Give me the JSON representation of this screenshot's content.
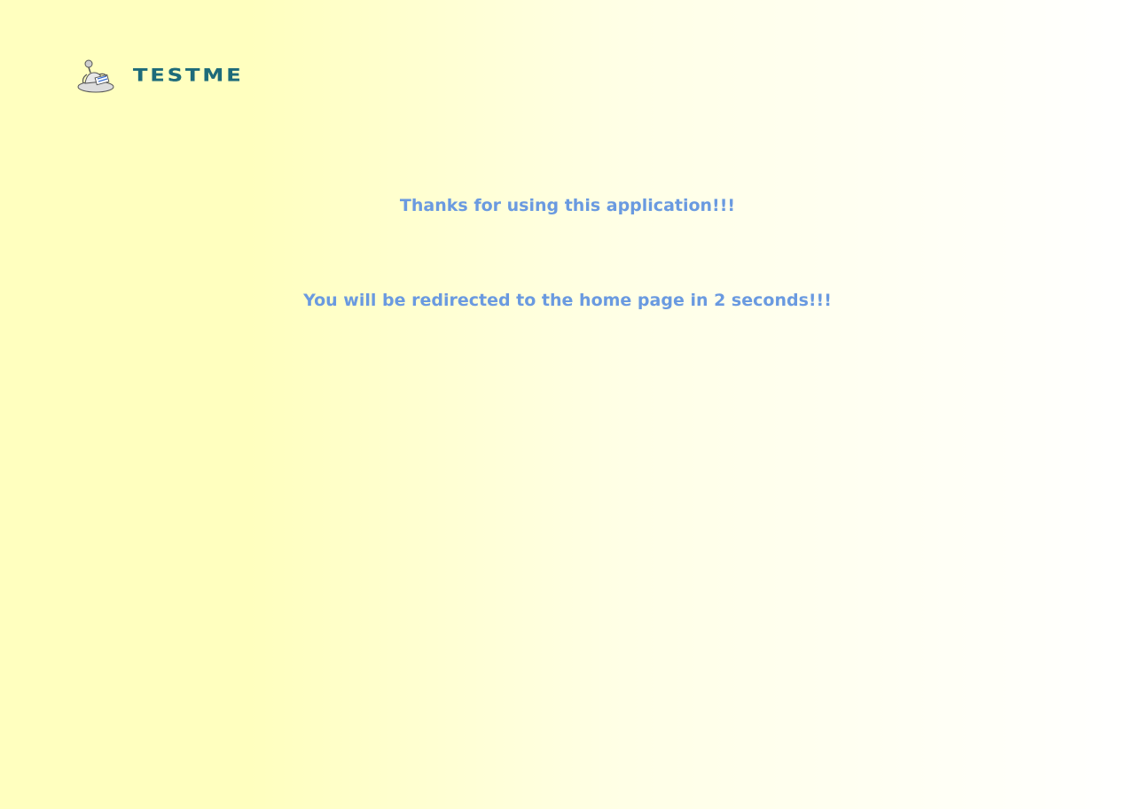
{
  "brand": {
    "name": "TESTME",
    "mascot_icon": "robot-mascot-icon",
    "text_color": "#1d6b7a"
  },
  "messages": {
    "thanks": "Thanks for using this application!!!",
    "redirect": "You will be redirected to the home page in 2 seconds!!!"
  },
  "colors": {
    "message_text": "#6a9ae0",
    "background_left": "#ffffbf",
    "background_right": "#ffffff"
  }
}
